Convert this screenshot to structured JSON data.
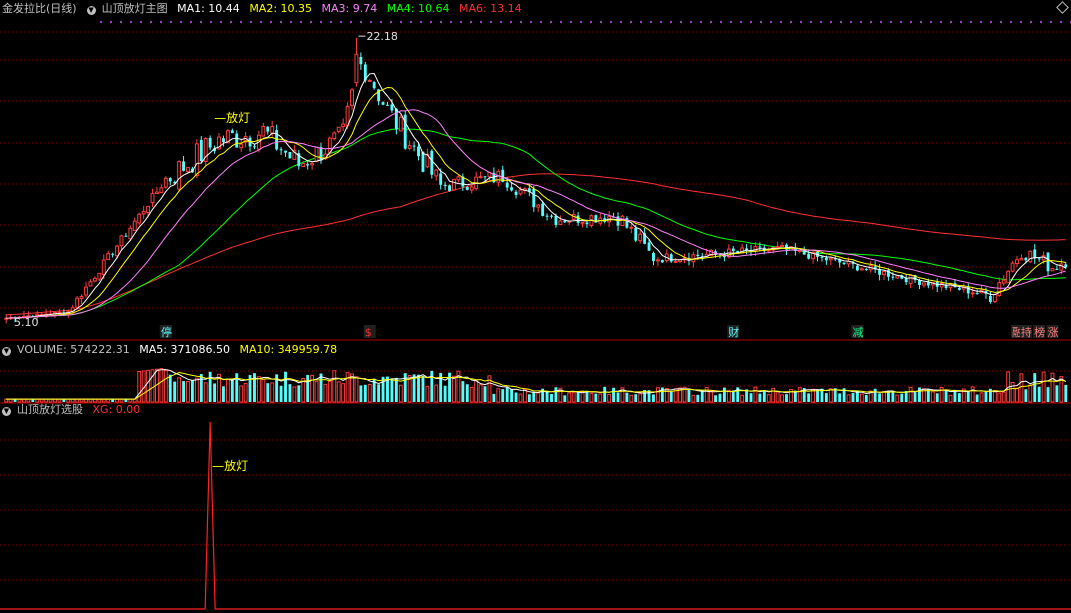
{
  "header": {
    "stock_name": "金发拉比(日线)",
    "indicator_name": "山顶放灯主图",
    "ma_labels": [
      {
        "text": "MA1: 10.44",
        "color": "#ffffff"
      },
      {
        "text": "MA2: 10.35",
        "color": "#ffff00"
      },
      {
        "text": "MA3: 9.74",
        "color": "#ff80ff"
      },
      {
        "text": "MA4: 10.64",
        "color": "#00ff00"
      },
      {
        "text": "MA6: 13.14",
        "color": "#ff3030"
      }
    ]
  },
  "volume_header": {
    "volume": "VOLUME: 574222.31",
    "ma5": "MA5: 371086.50",
    "ma10": "MA10: 349959.78"
  },
  "indicator_header": {
    "name": "山顶放灯选股",
    "xg": "XG: 0.00"
  },
  "colors": {
    "up": "#ff3c3c",
    "down": "#54fcfc",
    "grid": "#8b0000",
    "ma1": "#ffffff",
    "ma2": "#ffff00",
    "ma3": "#ff80ff",
    "ma4": "#00ff00",
    "ma6": "#ff3030"
  },
  "chart_data": {
    "type": "candlestick",
    "price_ylim": [
      4.0,
      23.4
    ],
    "max_label": "22.18",
    "min_label": "5.10",
    "signal_label": "放灯",
    "markers": [
      {
        "text": "停",
        "bar": 36,
        "color": "#54fcfc"
      },
      {
        "text": "$",
        "bar": 82,
        "color": "#ff3030"
      },
      {
        "text": "财",
        "bar": 164,
        "color": "#54fcfc"
      },
      {
        "text": "减",
        "bar": 192,
        "color": "#00ff80"
      },
      {
        "text": "融",
        "bar": 228,
        "color": "#ff8080"
      },
      {
        "text": "持",
        "bar": 230,
        "color": "#ff8080"
      },
      {
        "text": "榜",
        "bar": 233,
        "color": "#ff8080"
      },
      {
        "text": "涨",
        "bar": 236,
        "color": "#ff8080"
      }
    ],
    "volume_ylim": [
      0,
      620000
    ],
    "indicator": {
      "name": "XG",
      "peak_bar": 46,
      "ylim": [
        0,
        1
      ]
    },
    "segments": [
      {
        "from": 0,
        "to": 14,
        "start": 5.2,
        "end": 5.6,
        "noise": 0.05
      },
      {
        "from": 14,
        "to": 36,
        "start": 5.6,
        "end": 13.6,
        "noise": 0.25
      },
      {
        "from": 36,
        "to": 48,
        "start": 13.6,
        "end": 16.0,
        "noise": 0.9
      },
      {
        "from": 48,
        "to": 58,
        "start": 16.0,
        "end": 16.5,
        "noise": 0.9
      },
      {
        "from": 58,
        "to": 66,
        "start": 16.5,
        "end": 14.5,
        "noise": 0.9
      },
      {
        "from": 66,
        "to": 76,
        "start": 14.5,
        "end": 16.2,
        "noise": 0.8
      },
      {
        "from": 76,
        "to": 80,
        "start": 16.2,
        "end": 21.0,
        "noise": 0.9
      },
      {
        "from": 80,
        "to": 86,
        "start": 21.0,
        "end": 17.8,
        "noise": 0.9
      },
      {
        "from": 86,
        "to": 98,
        "start": 17.8,
        "end": 13.2,
        "noise": 0.8
      },
      {
        "from": 98,
        "to": 112,
        "start": 13.2,
        "end": 13.8,
        "noise": 0.5
      },
      {
        "from": 112,
        "to": 124,
        "start": 13.8,
        "end": 11.2,
        "noise": 0.5
      },
      {
        "from": 124,
        "to": 138,
        "start": 11.2,
        "end": 11.4,
        "noise": 0.4
      },
      {
        "from": 138,
        "to": 146,
        "start": 11.4,
        "end": 8.8,
        "noise": 0.6
      },
      {
        "from": 146,
        "to": 175,
        "start": 8.8,
        "end": 9.4,
        "noise": 0.3
      },
      {
        "from": 175,
        "to": 205,
        "start": 9.4,
        "end": 7.5,
        "noise": 0.25
      },
      {
        "from": 205,
        "to": 222,
        "start": 7.5,
        "end": 6.6,
        "noise": 0.25
      },
      {
        "from": 222,
        "to": 229,
        "start": 6.6,
        "end": 9.3,
        "noise": 0.5
      },
      {
        "from": 229,
        "to": 236,
        "start": 9.3,
        "end": 8.3,
        "noise": 0.5
      },
      {
        "from": 236,
        "to": 240,
        "start": 8.3,
        "end": 8.9,
        "noise": 0.5
      }
    ]
  }
}
